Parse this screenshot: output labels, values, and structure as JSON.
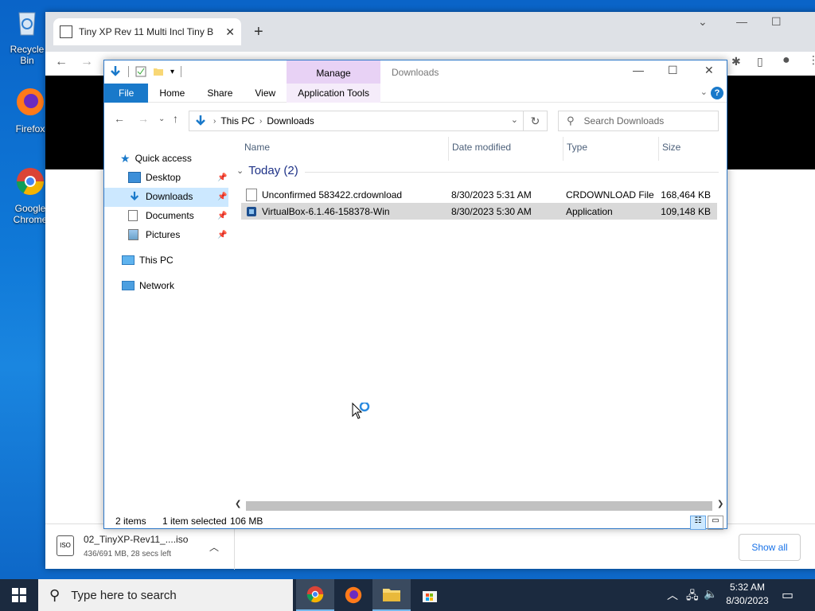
{
  "desktop": {
    "icons": [
      {
        "label": "Recycle Bin"
      },
      {
        "label": "Firefox"
      },
      {
        "label": "Google Chrome"
      }
    ]
  },
  "chrome": {
    "tab_title": "Tiny XP Rev 11 Multi Incl Tiny B",
    "tab_close": "✕",
    "new_tab": "+",
    "download": {
      "filename": "02_TinyXP-Rev11_....iso",
      "status": "436/691 MB, 28 secs left",
      "icon_text": "ISO"
    },
    "show_all_label": "Show all"
  },
  "explorer": {
    "window_title": "Downloads",
    "manage_label": "Manage",
    "ribbon_tabs": [
      "File",
      "Home",
      "Share",
      "View",
      "Application Tools"
    ],
    "breadcrumb": [
      "This PC",
      "Downloads"
    ],
    "search_placeholder": "Search Downloads",
    "nav": {
      "quick_access": "Quick access",
      "desktop": "Desktop",
      "downloads": "Downloads",
      "documents": "Documents",
      "pictures": "Pictures",
      "this_pc": "This PC",
      "network": "Network"
    },
    "columns": {
      "name": "Name",
      "date": "Date modified",
      "type": "Type",
      "size": "Size"
    },
    "group_label": "Today (2)",
    "files": [
      {
        "name": "Unconfirmed 583422.crdownload",
        "date": "8/30/2023 5:31 AM",
        "type": "CRDOWNLOAD File",
        "size": "168,464 KB"
      },
      {
        "name": "VirtualBox-6.1.46-158378-Win",
        "date": "8/30/2023 5:30 AM",
        "type": "Application",
        "size": "109,148 KB"
      }
    ],
    "status": {
      "count": "2 items",
      "selected": "1 item selected",
      "size": "106 MB"
    }
  },
  "taskbar": {
    "search_placeholder": "Type here to search",
    "time": "5:32 AM",
    "date": "8/30/2023"
  }
}
